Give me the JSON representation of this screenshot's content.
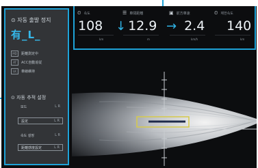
{
  "sidebar": {
    "title": "⊙ 자동 출발 정지",
    "status": "有_L_",
    "rows": [
      {
        "chip": "MD",
        "label": "距離測定中"
      },
      {
        "chip": "AT",
        "label": "ACC自動追従"
      },
      {
        "chip": "LK",
        "label": "車線維持"
      }
    ],
    "subtitle": "⊙ 자동 추적 설정",
    "buttons": [
      {
        "label": "모드",
        "value": "L R"
      },
      {
        "label": "設定",
        "value": "L R"
      },
      {
        "label": "속도 설정",
        "value": "L R"
      },
      {
        "label": "距離感度設定",
        "value": "L R"
      }
    ]
  },
  "metrics": [
    {
      "icon": "speed-icon",
      "glyph": "⏲",
      "label": "속도",
      "value": "108",
      "arrow": "",
      "unit": "km"
    },
    {
      "icon": "distance-icon",
      "glyph": "☰",
      "label": "車間距離",
      "value": "12.9",
      "arrow": "↓",
      "unit": "m"
    },
    {
      "icon": "target-icon",
      "glyph": "▣",
      "label": "前方車速",
      "value": "2.4",
      "arrow": "→",
      "unit": "km/h"
    },
    {
      "icon": "limit-icon",
      "glyph": "⏲",
      "label": "제한속도",
      "value": "140",
      "arrow": "",
      "unit": "km"
    }
  ],
  "colors": {
    "accent": "#1ea3d8",
    "panel": "#323437",
    "background": "#0c0d0f",
    "target_box": "#d6c94a"
  }
}
